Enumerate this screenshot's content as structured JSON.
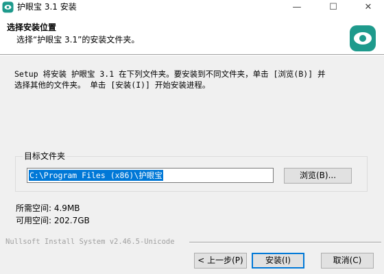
{
  "window": {
    "title": "护眼宝 3.1 安装",
    "minimize_glyph": "—",
    "maximize_glyph": "☐",
    "close_glyph": "✕"
  },
  "header": {
    "title": "选择安装位置",
    "subtitle": "选择“护眼宝 3.1”的安装文件夹。",
    "logo_icon": "eye-logo-icon"
  },
  "description": {
    "line1": "Setup 将安装 护眼宝 3.1 在下列文件夹。要安装到不同文件夹，单击 [浏览(B)] 并",
    "line2": "选择其他的文件夹。 单击 [安装(I)] 开始安装进程。"
  },
  "target": {
    "group_label": "目标文件夹",
    "path_value": "C:\\Program Files (x86)\\护眼宝",
    "browse_label": "浏览(B)..."
  },
  "space": {
    "required": "所需空间: 4.9MB",
    "available": "可用空间: 202.7GB"
  },
  "footer": {
    "branding": "Nullsoft Install System v2.46.5-Unicode",
    "back_label": "< 上一步(P)",
    "install_label": "安装(I)",
    "cancel_label": "取消(C)"
  },
  "colors": {
    "accent": "#0078d7",
    "app_icon": "#1e9a8c"
  }
}
